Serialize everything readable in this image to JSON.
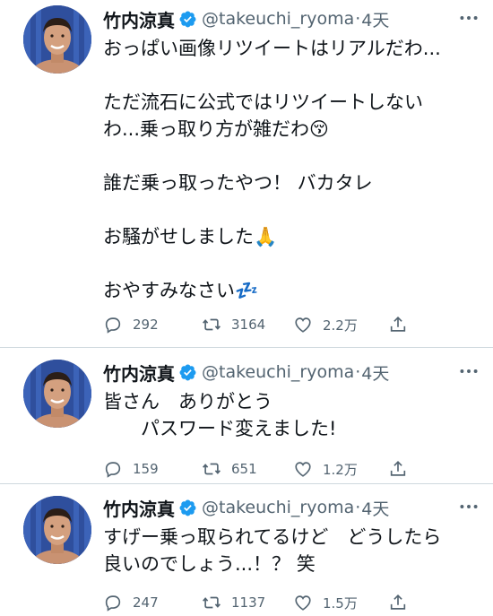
{
  "tweets": [
    {
      "name": "竹内涼真",
      "handle": "@takeuchi_ryoma",
      "dot": "·",
      "time": "4天",
      "lines": [
        "おっぱい画像リツイートはリアルだわ...",
        "",
        "ただ流石に公式ではリツイートしない",
        "わ...乗っ取り方が雑だわ😚",
        "",
        "誰だ乗っ取ったやつ！ バカタレ",
        "",
        "お騒がせしました🙏",
        "",
        "おやすみなさい💤"
      ],
      "replies": "292",
      "retweets": "3164",
      "likes": "2.2万"
    },
    {
      "name": "竹内涼真",
      "handle": "@takeuchi_ryoma",
      "dot": "·",
      "time": "4天",
      "lines": [
        "皆さん　ありがとう",
        "　　パスワード変えました!"
      ],
      "replies": "159",
      "retweets": "651",
      "likes": "1.2万"
    },
    {
      "name": "竹内涼真",
      "handle": "@takeuchi_ryoma",
      "dot": "·",
      "time": "4天",
      "lines": [
        "すげー乗っ取られてるけど　どうしたら",
        "良いのでしょう...！？ 笑"
      ],
      "replies": "247",
      "retweets": "1137",
      "likes": "1.5万"
    }
  ],
  "icons": {
    "verified": "verified-badge-icon",
    "more": "more-icon",
    "reply": "reply-icon",
    "retweet": "retweet-icon",
    "like": "like-icon",
    "share": "share-icon"
  },
  "colors": {
    "verified": "#1d9bf0",
    "secondary_text": "#536471",
    "divider": "#cfd9de"
  }
}
